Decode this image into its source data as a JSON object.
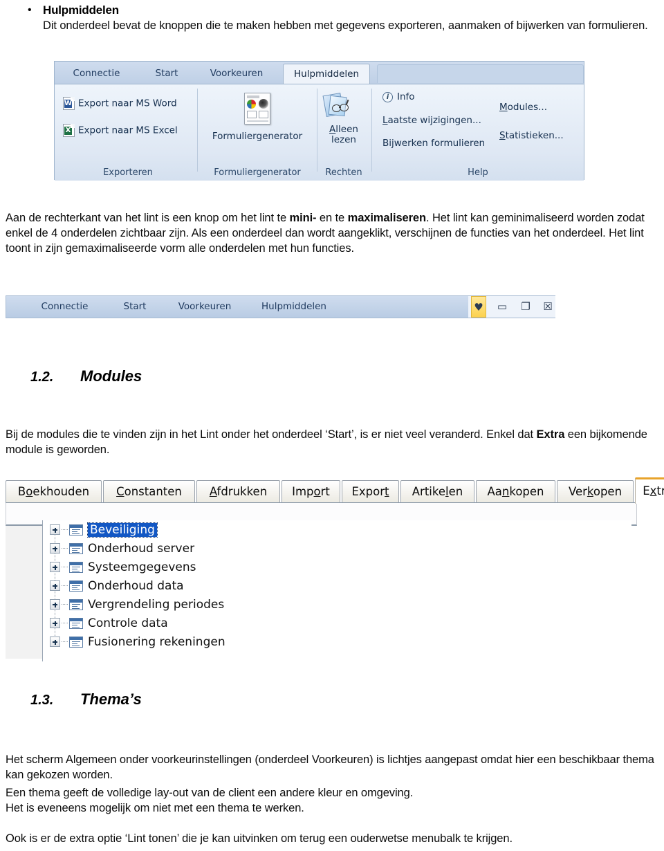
{
  "document": {
    "bullet": {
      "marker": "•",
      "title": "Hulpmiddelen",
      "body": "Dit onderdeel bevat de knoppen die te maken hebben met gegevens exporteren, aanmaken of bijwerken van formulieren."
    },
    "para_ribbon": {
      "line1_a": "Aan de rechterkant van het lint is een knop om het lint te ",
      "line1_b": "mini-",
      "line1_c": " en te ",
      "line1_d": "maximaliseren",
      "line1_e": ". Het lint kan geminimaliseerd worden zodat enkel de 4 onderdelen zichtbaar zijn. Als een onderdeel dan wordt aangeklikt, verschijnen de functies van het onderdeel. Het lint toont in zijn gemaximaliseerde vorm alle onderdelen met hun functies."
    },
    "heading_modules": {
      "number": "1.2.",
      "text": "Modules"
    },
    "para_modules": {
      "a": "Bij de modules die te vinden zijn in het Lint onder het onderdeel ‘Start’, is er niet veel veranderd. Enkel dat ",
      "b": "Extra",
      "c": " een bijkomende module is geworden."
    },
    "heading_themas": {
      "number": "1.3.",
      "text": "Thema’s"
    },
    "para_themas": {
      "l1": "Het scherm Algemeen onder voorkeurinstellingen (onderdeel Voorkeuren) is lichtjes aangepast omdat hier een beschikbaar thema kan gekozen worden.",
      "l2": "Een thema geeft de volledige lay-out van de client een andere kleur en omgeving.",
      "l3": "Het is eveneens mogelijk om niet met een thema te werken.",
      "l4": "Ook is er de extra optie ‘Lint tonen’ die je kan uitvinken om terug een ouderwetse menubalk te krijgen."
    }
  },
  "ribbon_maximized": {
    "tabs": [
      {
        "label": "Connectie",
        "active": false
      },
      {
        "label": "Start",
        "active": false
      },
      {
        "label": "Voorkeuren",
        "active": false
      },
      {
        "label": "Hulpmiddelen",
        "active": true
      }
    ],
    "groups": [
      {
        "name": "Exporteren",
        "items": [
          {
            "label": "Export naar MS Word",
            "icon": "word-document-icon"
          },
          {
            "label": "Export naar MS Excel",
            "icon": "excel-document-icon"
          }
        ]
      },
      {
        "name": "Formuliergenerator",
        "items": [
          {
            "label": "Formuliergenerator",
            "icon": "form-generator-icon"
          }
        ]
      },
      {
        "name": "Rechten",
        "items": [
          {
            "label_line1": "Alleen",
            "label_line2": "lezen",
            "mnemonic": "A",
            "icon": "read-only-glasses-icon"
          }
        ]
      },
      {
        "name": "Help",
        "items": [
          {
            "label": "Info",
            "icon": "info-icon"
          },
          {
            "label": "Laatste wijzigingen...",
            "mnemonic": "L"
          },
          {
            "label": "Bijwerken formulieren"
          },
          {
            "label": "Modules...",
            "mnemonic": "M"
          },
          {
            "label": "Statistieken...",
            "mnemonic": "S"
          }
        ]
      }
    ]
  },
  "ribbon_minimized": {
    "tabs": [
      "Connectie",
      "Start",
      "Voorkeuren",
      "Hulpmiddelen"
    ],
    "window_buttons": [
      {
        "name": "minimize-ribbon-button",
        "glyph": "♥",
        "highlighted": true
      },
      {
        "name": "minimize-window-button",
        "glyph": "▭",
        "highlighted": false
      },
      {
        "name": "restore-window-button",
        "glyph": "❐",
        "highlighted": false
      },
      {
        "name": "close-window-button",
        "glyph": "☒",
        "highlighted": false
      }
    ]
  },
  "module_tabs": {
    "items": [
      {
        "label": "Boekhouden",
        "mnemonic_index": 1,
        "active": false
      },
      {
        "label": "Constanten",
        "mnemonic_index": 0,
        "active": false
      },
      {
        "label": "Afdrukken",
        "mnemonic_index": 0,
        "active": false
      },
      {
        "label": "Import",
        "mnemonic_index": 4,
        "active": false
      },
      {
        "label": "Export",
        "mnemonic_index": 5,
        "active": false
      },
      {
        "label": "Artikelen",
        "mnemonic_index": 6,
        "active": false
      },
      {
        "label": "Aankopen",
        "mnemonic_index": 2,
        "active": false
      },
      {
        "label": "Verkopen",
        "mnemonic_index": 3,
        "active": false
      },
      {
        "label": "Extra",
        "mnemonic_index": 1,
        "active": true
      }
    ]
  },
  "tree": {
    "items": [
      {
        "label": "Beveiliging",
        "selected": true,
        "expandable": true
      },
      {
        "label": "Onderhoud server",
        "selected": false,
        "expandable": true
      },
      {
        "label": "Systeemgegevens",
        "selected": false,
        "expandable": true
      },
      {
        "label": "Onderhoud data",
        "selected": false,
        "expandable": true
      },
      {
        "label": "Vergrendeling periodes",
        "selected": false,
        "expandable": true
      },
      {
        "label": "Controle data",
        "selected": false,
        "expandable": true
      },
      {
        "label": "Fusionering rekeningen",
        "selected": false,
        "expandable": true
      }
    ]
  },
  "colors": {
    "ribbon_tab_bar": "#cfdcee",
    "ribbon_body": "#e8eef7",
    "active_tab": "#eef3fa",
    "selection_blue": "#1257c4",
    "active_module_tab_accent": "#e8a32b",
    "highlight_yellow": "#fcd24f"
  }
}
